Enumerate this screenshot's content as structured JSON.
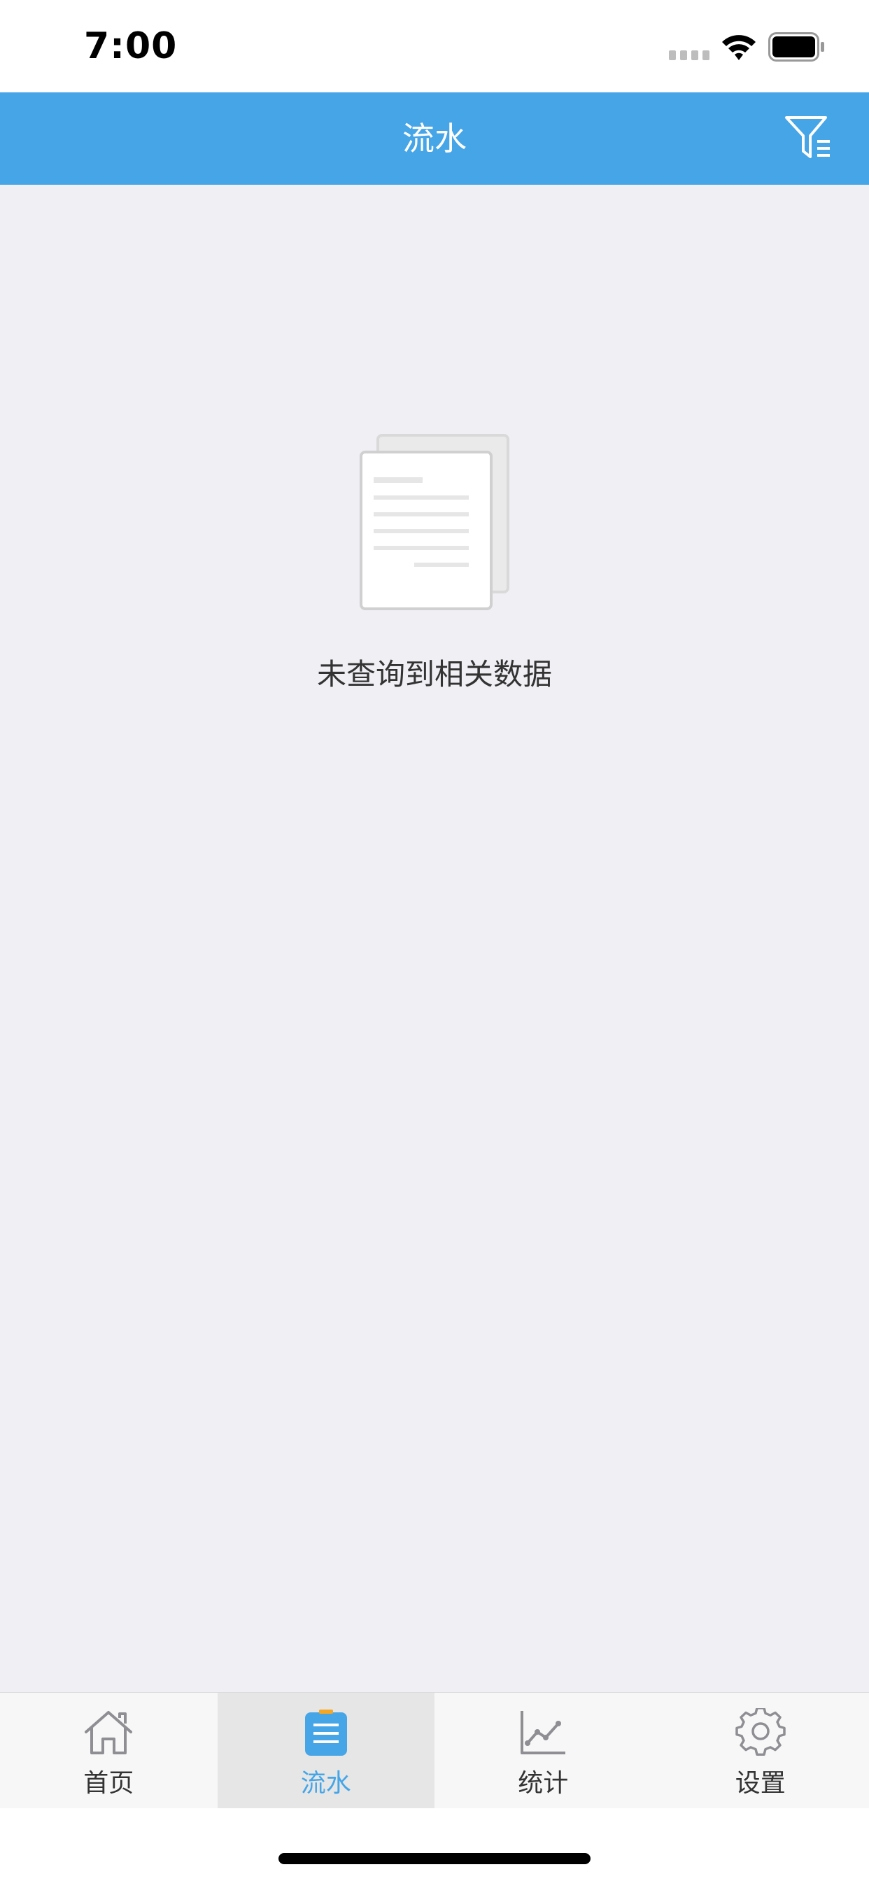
{
  "status_bar": {
    "time": "7:00"
  },
  "nav": {
    "title": "流水",
    "filter_icon": "filter-icon"
  },
  "empty_state": {
    "icon": "document-icon",
    "message": "未查询到相关数据"
  },
  "tabs": [
    {
      "label": "首页",
      "icon": "home-icon",
      "active": false
    },
    {
      "label": "流水",
      "icon": "clipboard-list-icon",
      "active": true
    },
    {
      "label": "统计",
      "icon": "line-chart-icon",
      "active": false
    },
    {
      "label": "设置",
      "icon": "gear-icon",
      "active": false
    }
  ],
  "colors": {
    "accent": "#46A5E7",
    "background": "#EFEFF4",
    "tab_bar": "#F7F7F7",
    "tab_active_bg": "#E6E6E6",
    "text": "#333333",
    "clipboard_clip": "#F5A623"
  }
}
